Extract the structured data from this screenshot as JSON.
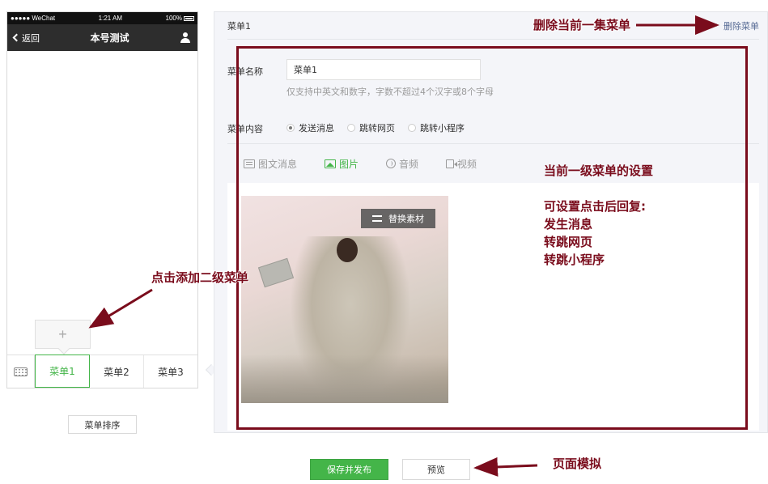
{
  "phone": {
    "status": {
      "signal": "●●●●● WeChat",
      "time": "1:21 AM",
      "battery": "100%"
    },
    "nav": {
      "back_label": "返回",
      "title": "本号测试"
    },
    "add_sub_symbol": "+",
    "menu_tabs": [
      {
        "label": "菜单1",
        "active": true
      },
      {
        "label": "菜单2",
        "active": false
      },
      {
        "label": "菜单3",
        "active": false
      }
    ]
  },
  "sort_button": "菜单排序",
  "panel": {
    "header_title": "菜单1",
    "delete_link": "删除菜单",
    "name_label": "菜单名称",
    "name_value": "菜单1",
    "name_hint": "仅支持中英文和数字，字数不超过4个汉字或8个字母",
    "content_label": "菜单内容",
    "content_options": [
      {
        "label": "发送消息",
        "checked": true
      },
      {
        "label": "跳转网页",
        "checked": false
      },
      {
        "label": "跳转小程序",
        "checked": false
      }
    ],
    "content_tabs": [
      {
        "label": "图文消息",
        "icon": "doc-icon",
        "active": false
      },
      {
        "label": "图片",
        "icon": "image-icon",
        "active": true
      },
      {
        "label": "音频",
        "icon": "audio-icon",
        "active": false
      },
      {
        "label": "视频",
        "icon": "video-icon",
        "active": false
      }
    ],
    "replace_button": "替换素材"
  },
  "annotations": {
    "delete_note": "删除当前一集菜单",
    "add_note": "点击添加二级菜单",
    "settings_title": "当前一级菜单的设置",
    "settings_lines": [
      "可设置点击后回复:",
      "发生消息",
      "转跳网页",
      "转跳小程序"
    ],
    "preview_note": "页面模拟"
  },
  "footer": {
    "save_publish": "保存并发布",
    "preview": "预览"
  },
  "colors": {
    "accent": "#44b549",
    "annotation": "#7a0c1c",
    "link": "#576b95",
    "panel_bg": "#f4f5f9"
  }
}
